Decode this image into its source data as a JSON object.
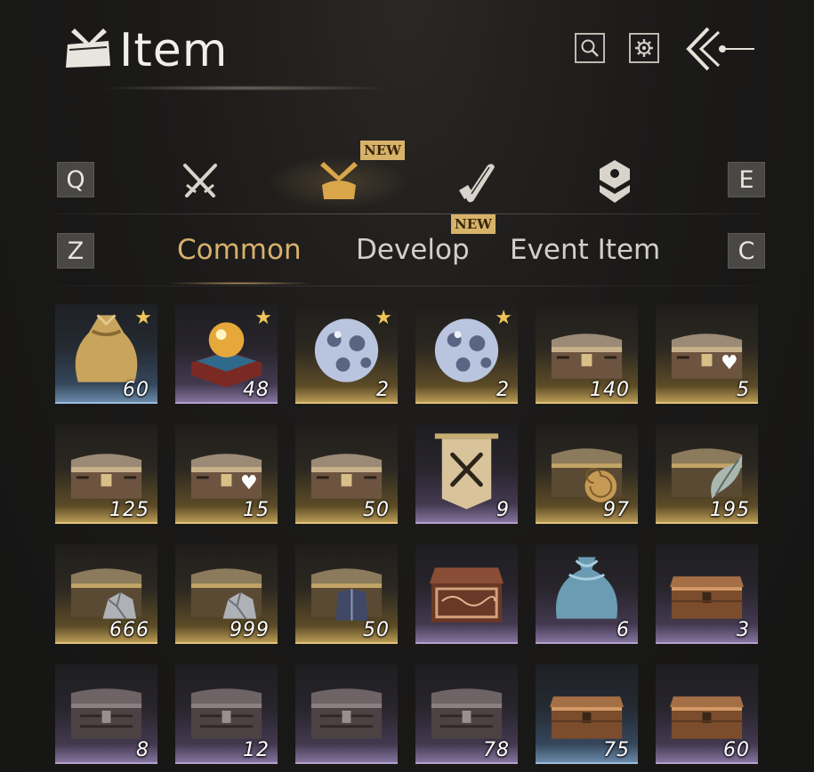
{
  "header": {
    "title": "Item",
    "icons": [
      "title-bundle-icon",
      "search-icon",
      "gear-icon",
      "back-arrow-icon"
    ]
  },
  "categories": {
    "prev_key": "Q",
    "next_key": "E",
    "icons": [
      "crossed-swords-icon",
      "bundle-icon",
      "scroll-icon",
      "emblem-icon"
    ],
    "active_index": 1,
    "new_badge": "NEW"
  },
  "subtabs": {
    "prev_key": "Z",
    "next_key": "C",
    "items": [
      "Common",
      "Develop",
      "Event Item"
    ],
    "active_index": 0,
    "new_badge": "NEW"
  },
  "colors": {
    "accent_gold": "#d9b06c",
    "rarity_gold": "#c2a25a",
    "rarity_purple": "#8b79a5",
    "rarity_blue": "#6f8fb0"
  },
  "items": [
    {
      "name": "gold-pouch",
      "count": "60",
      "rarity": "blue",
      "star": true,
      "heart": false
    },
    {
      "name": "orb-pedestal",
      "count": "48",
      "rarity": "purple",
      "star": true,
      "heart": false
    },
    {
      "name": "moon-stone",
      "count": "2",
      "rarity": "gold",
      "star": true,
      "heart": false
    },
    {
      "name": "moon-stone",
      "count": "2",
      "rarity": "gold",
      "star": true,
      "heart": false
    },
    {
      "name": "ornate-chest",
      "count": "140",
      "rarity": "gold",
      "star": false,
      "heart": false
    },
    {
      "name": "ornate-chest",
      "count": "5",
      "rarity": "gold",
      "star": false,
      "heart": true
    },
    {
      "name": "ornate-chest",
      "count": "125",
      "rarity": "gold",
      "star": false,
      "heart": false
    },
    {
      "name": "ornate-chest",
      "count": "15",
      "rarity": "gold",
      "star": false,
      "heart": true
    },
    {
      "name": "ornate-chest",
      "count": "50",
      "rarity": "gold",
      "star": false,
      "heart": false
    },
    {
      "name": "battle-banner",
      "count": "9",
      "rarity": "purple",
      "star": false,
      "heart": false
    },
    {
      "name": "shell-chest",
      "count": "97",
      "rarity": "gold",
      "star": false,
      "heart": false
    },
    {
      "name": "leaf-chest",
      "count": "195",
      "rarity": "gold",
      "star": false,
      "heart": false
    },
    {
      "name": "ore-chest",
      "count": "666",
      "rarity": "gold",
      "star": false,
      "heart": false
    },
    {
      "name": "ore-chest",
      "count": "999",
      "rarity": "gold",
      "star": false,
      "heart": false
    },
    {
      "name": "armor-chest",
      "count": "50",
      "rarity": "gold",
      "star": false,
      "heart": false
    },
    {
      "name": "carved-chest",
      "count": "",
      "rarity": "purple",
      "star": false,
      "heart": false
    },
    {
      "name": "silk-pouch",
      "count": "6",
      "rarity": "purple",
      "star": false,
      "heart": false
    },
    {
      "name": "wooden-chest",
      "count": "3",
      "rarity": "purple",
      "star": false,
      "heart": false
    },
    {
      "name": "iron-chest",
      "count": "8",
      "rarity": "purple",
      "star": false,
      "heart": false
    },
    {
      "name": "iron-chest",
      "count": "12",
      "rarity": "purple",
      "star": false,
      "heart": false
    },
    {
      "name": "iron-chest",
      "count": "",
      "rarity": "purple",
      "star": false,
      "heart": false
    },
    {
      "name": "iron-chest",
      "count": "78",
      "rarity": "purple",
      "star": false,
      "heart": false
    },
    {
      "name": "wooden-chest",
      "count": "75",
      "rarity": "blue",
      "star": false,
      "heart": false
    },
    {
      "name": "wooden-chest",
      "count": "60",
      "rarity": "purple",
      "star": false,
      "heart": false
    }
  ]
}
